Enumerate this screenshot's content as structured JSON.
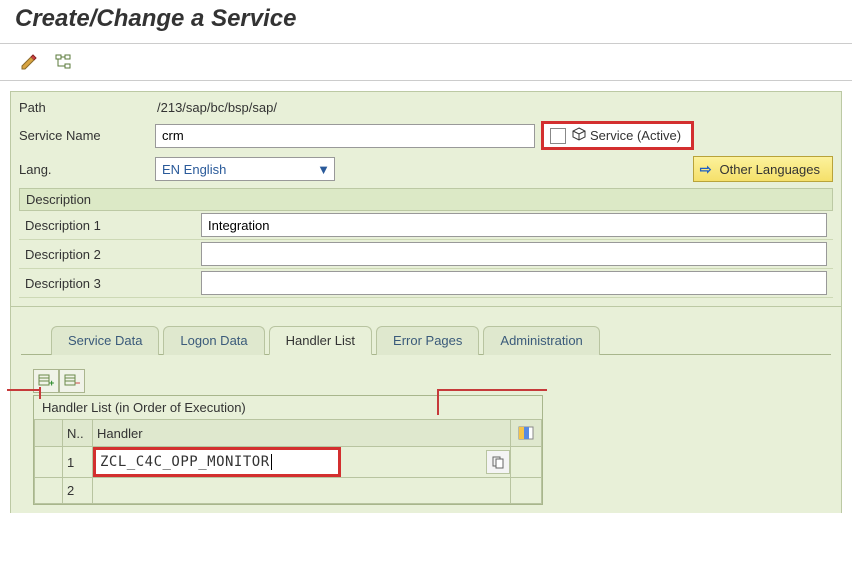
{
  "page": {
    "title": "Create/Change a Service"
  },
  "form": {
    "path_label": "Path",
    "path_value": "/213/sap/bc/bsp/sap/",
    "service_name_label": "Service Name",
    "service_name_value": "crm",
    "status_text": "Service (Active)",
    "lang_label": "Lang.",
    "lang_value": "EN English",
    "other_langs_label": "Other Languages"
  },
  "description": {
    "header": "Description",
    "rows": [
      {
        "label": "Description 1",
        "value": "Integration"
      },
      {
        "label": "Description 2",
        "value": ""
      },
      {
        "label": "Description 3",
        "value": ""
      }
    ]
  },
  "tabs": [
    {
      "label": "Service Data",
      "active": false
    },
    {
      "label": "Logon Data",
      "active": false
    },
    {
      "label": "Handler List",
      "active": true
    },
    {
      "label": "Error Pages",
      "active": false
    },
    {
      "label": "Administration",
      "active": false
    }
  ],
  "handler_list": {
    "title": "Handler List (in Order of Execution)",
    "columns": {
      "num": "N..",
      "handler": "Handler"
    },
    "rows": [
      {
        "num": "1",
        "handler": "ZCL_C4C_OPP_MONITOR"
      },
      {
        "num": "2",
        "handler": ""
      }
    ]
  }
}
